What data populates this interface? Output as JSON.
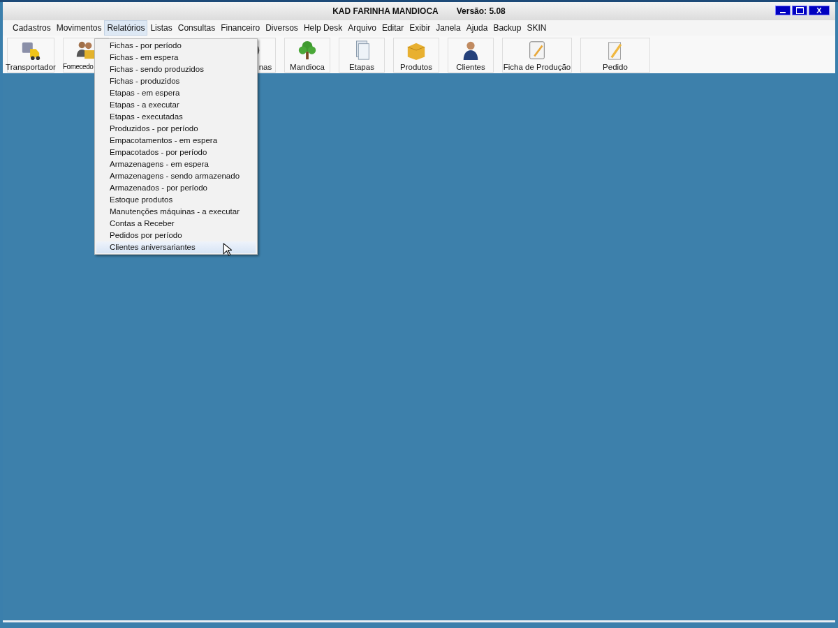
{
  "window": {
    "title": "KAD FARINHA MANDIOCA",
    "version": "Versão: 5.08",
    "controls": [
      {
        "kind": "minimize"
      },
      {
        "kind": "maximize"
      },
      {
        "kind": "close",
        "label": "X"
      }
    ]
  },
  "menu_bar": [
    {
      "label": "Cadastros",
      "selected": false
    },
    {
      "label": "Movimentos",
      "selected": false
    },
    {
      "label": "Relatórios",
      "selected": true
    },
    {
      "label": "Listas",
      "selected": false
    },
    {
      "label": "Consultas",
      "selected": false
    },
    {
      "label": "Financeiro",
      "selected": false
    },
    {
      "label": "Diversos",
      "selected": false
    },
    {
      "label": "Help Desk",
      "selected": false
    },
    {
      "label": "Arquivo",
      "selected": false
    },
    {
      "label": "Editar",
      "selected": false
    },
    {
      "label": "Exibir",
      "selected": false
    },
    {
      "label": "Janela",
      "selected": false
    },
    {
      "label": "Ajuda",
      "selected": false
    },
    {
      "label": "Backup",
      "selected": false
    },
    {
      "label": "SKIN",
      "selected": false
    }
  ],
  "toolbar": [
    {
      "label": "Transportador",
      "kind": "truck"
    },
    {
      "label": "Fornecedo",
      "kind": "people"
    },
    {
      "label": "nas",
      "kind": "hidden"
    },
    {
      "label": "Mandioca",
      "kind": "tree"
    },
    {
      "label": "Etapas",
      "kind": "pages"
    },
    {
      "label": "Produtos",
      "kind": "box"
    },
    {
      "label": "Clientes",
      "kind": "person"
    },
    {
      "label": "Ficha de Produção",
      "kind": "notebook"
    },
    {
      "label": "Pedido",
      "kind": "pencil"
    }
  ],
  "dropdown": [
    {
      "label": "Fichas - por período",
      "selected": false
    },
    {
      "label": "Fichas - em espera",
      "selected": false
    },
    {
      "label": "Fichas - sendo produzidos",
      "selected": false
    },
    {
      "label": "Fichas - produzidos",
      "selected": false
    },
    {
      "label": "Etapas - em espera",
      "selected": false
    },
    {
      "label": "Etapas - a executar",
      "selected": false
    },
    {
      "label": "Etapas - executadas",
      "selected": false
    },
    {
      "label": "Produzidos - por período",
      "selected": false
    },
    {
      "label": "Empacotamentos - em espera",
      "selected": false
    },
    {
      "label": "Empacotados - por período",
      "selected": false
    },
    {
      "label": "Armazenagens - em espera",
      "selected": false
    },
    {
      "label": "Armazenagens - sendo armazenado",
      "selected": false
    },
    {
      "label": "Armazenados - por período",
      "selected": false
    },
    {
      "label": "Estoque produtos",
      "selected": false
    },
    {
      "label": "Manutenções máquinas - a executar",
      "selected": false
    },
    {
      "label": "Contas a Receber",
      "selected": false
    },
    {
      "label": "Pedidos por período",
      "selected": false
    },
    {
      "label": "Clientes aniversariantes",
      "selected": true
    }
  ]
}
